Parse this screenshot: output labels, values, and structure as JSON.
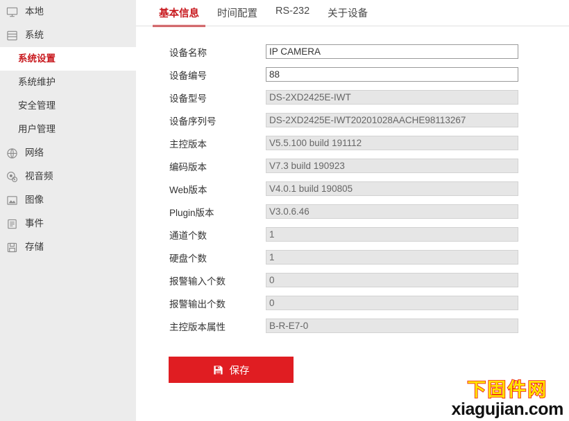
{
  "sidebar": {
    "items": [
      {
        "label": "本地",
        "icon": "monitor-icon",
        "has_icon": true,
        "sub": false,
        "active": false
      },
      {
        "label": "系统",
        "icon": "system-icon",
        "has_icon": true,
        "sub": false,
        "active": false
      },
      {
        "label": "系统设置",
        "icon": "",
        "has_icon": false,
        "sub": true,
        "active": true
      },
      {
        "label": "系统维护",
        "icon": "",
        "has_icon": false,
        "sub": true,
        "active": false
      },
      {
        "label": "安全管理",
        "icon": "",
        "has_icon": false,
        "sub": true,
        "active": false
      },
      {
        "label": "用户管理",
        "icon": "",
        "has_icon": false,
        "sub": true,
        "active": false
      },
      {
        "label": "网络",
        "icon": "network-icon",
        "has_icon": true,
        "sub": false,
        "active": false
      },
      {
        "label": "视音频",
        "icon": "video-icon",
        "has_icon": true,
        "sub": false,
        "active": false
      },
      {
        "label": "图像",
        "icon": "image-icon",
        "has_icon": true,
        "sub": false,
        "active": false
      },
      {
        "label": "事件",
        "icon": "event-icon",
        "has_icon": true,
        "sub": false,
        "active": false
      },
      {
        "label": "存储",
        "icon": "storage-icon",
        "has_icon": true,
        "sub": false,
        "active": false
      }
    ]
  },
  "tabs": [
    {
      "label": "基本信息",
      "active": true
    },
    {
      "label": "时间配置",
      "active": false
    },
    {
      "label": "RS-232",
      "active": false
    },
    {
      "label": "关于设备",
      "active": false
    }
  ],
  "form": {
    "fields": [
      {
        "label": "设备名称",
        "value": "IP CAMERA",
        "readonly": false
      },
      {
        "label": "设备编号",
        "value": "88",
        "readonly": false
      },
      {
        "label": "设备型号",
        "value": "DS-2XD2425E-IWT",
        "readonly": true
      },
      {
        "label": "设备序列号",
        "value": "DS-2XD2425E-IWT20201028AACHE98113267",
        "readonly": true
      },
      {
        "label": "主控版本",
        "value": "V5.5.100 build 191112",
        "readonly": true
      },
      {
        "label": "编码版本",
        "value": "V7.3 build 190923",
        "readonly": true
      },
      {
        "label": "Web版本",
        "value": "V4.0.1 build 190805",
        "readonly": true
      },
      {
        "label": "Plugin版本",
        "value": "V3.0.6.46",
        "readonly": true
      },
      {
        "label": "通道个数",
        "value": "1",
        "readonly": true
      },
      {
        "label": "硬盘个数",
        "value": "1",
        "readonly": true
      },
      {
        "label": "报警输入个数",
        "value": "0",
        "readonly": true
      },
      {
        "label": "报警输出个数",
        "value": "0",
        "readonly": true
      },
      {
        "label": "主控版本属性",
        "value": "B-R-E7-0",
        "readonly": true
      }
    ]
  },
  "save": {
    "label": "保存",
    "icon": "save-floppy-icon"
  },
  "watermark": {
    "line1": "下固件网",
    "line2": "xiagujian.com"
  },
  "colors": {
    "accent_red": "#c8191e",
    "button_red": "#e01d22",
    "sidebar_bg": "#ececec",
    "readonly_bg": "#e6e6e6",
    "watermark_yellow": "#ffe600",
    "watermark_outline": "#ee1111"
  }
}
